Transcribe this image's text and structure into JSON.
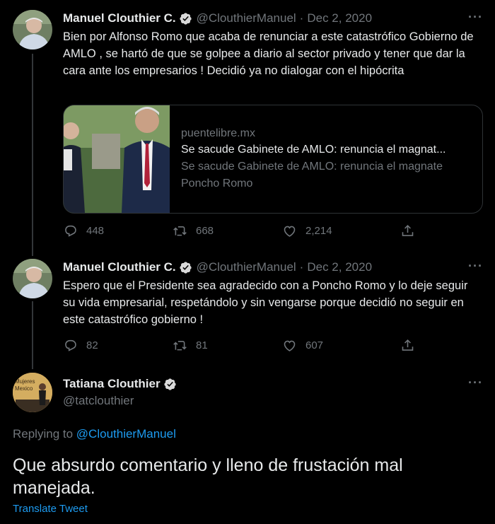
{
  "tweet1": {
    "author_name": "Manuel Clouthier C.",
    "handle": "@ClouthierManuel",
    "separator": "·",
    "date": "Dec 2, 2020",
    "text": "Bien por Alfonso Romo que acaba de renunciar a este catastrófico Gobierno de AMLO , se hartó de que se golpee a diario al sector privado y tener que dar la cara ante los empresarios ! Decidió ya no dialogar con el hipócrita",
    "card": {
      "domain": "puentelibre.mx",
      "title": "Se sacude Gabinete de AMLO: renuncia el magnat...",
      "description": "Se sacude Gabinete de AMLO: renuncia el magnate Poncho Romo"
    },
    "replies": "448",
    "retweets": "668",
    "likes": "2,214"
  },
  "tweet2": {
    "author_name": "Manuel Clouthier C.",
    "handle": "@ClouthierManuel",
    "separator": "·",
    "date": "Dec 2, 2020",
    "text": "Espero que el Presidente sea agradecido con a Poncho Romo y lo deje seguir su vida empresarial, respetándolo y sin vengarse porque decidió no seguir en este catastrófico gobierno !",
    "replies": "82",
    "retweets": "81",
    "likes": "607"
  },
  "main_tweet": {
    "author_name": "Tatiana Clouthier",
    "handle": "@tatclouthier",
    "avatar_text": "Mujeres Mexico",
    "replying_label": "Replying to",
    "replying_handle": "@ClouthierManuel",
    "text": "Que absurdo comentario y lleno de frustación mal manejada.",
    "translate_label": "Translate Tweet"
  },
  "colors": {
    "background": "#000000",
    "text": "#e7e9ea",
    "muted": "#71767b",
    "accent": "#1d9bf0"
  }
}
